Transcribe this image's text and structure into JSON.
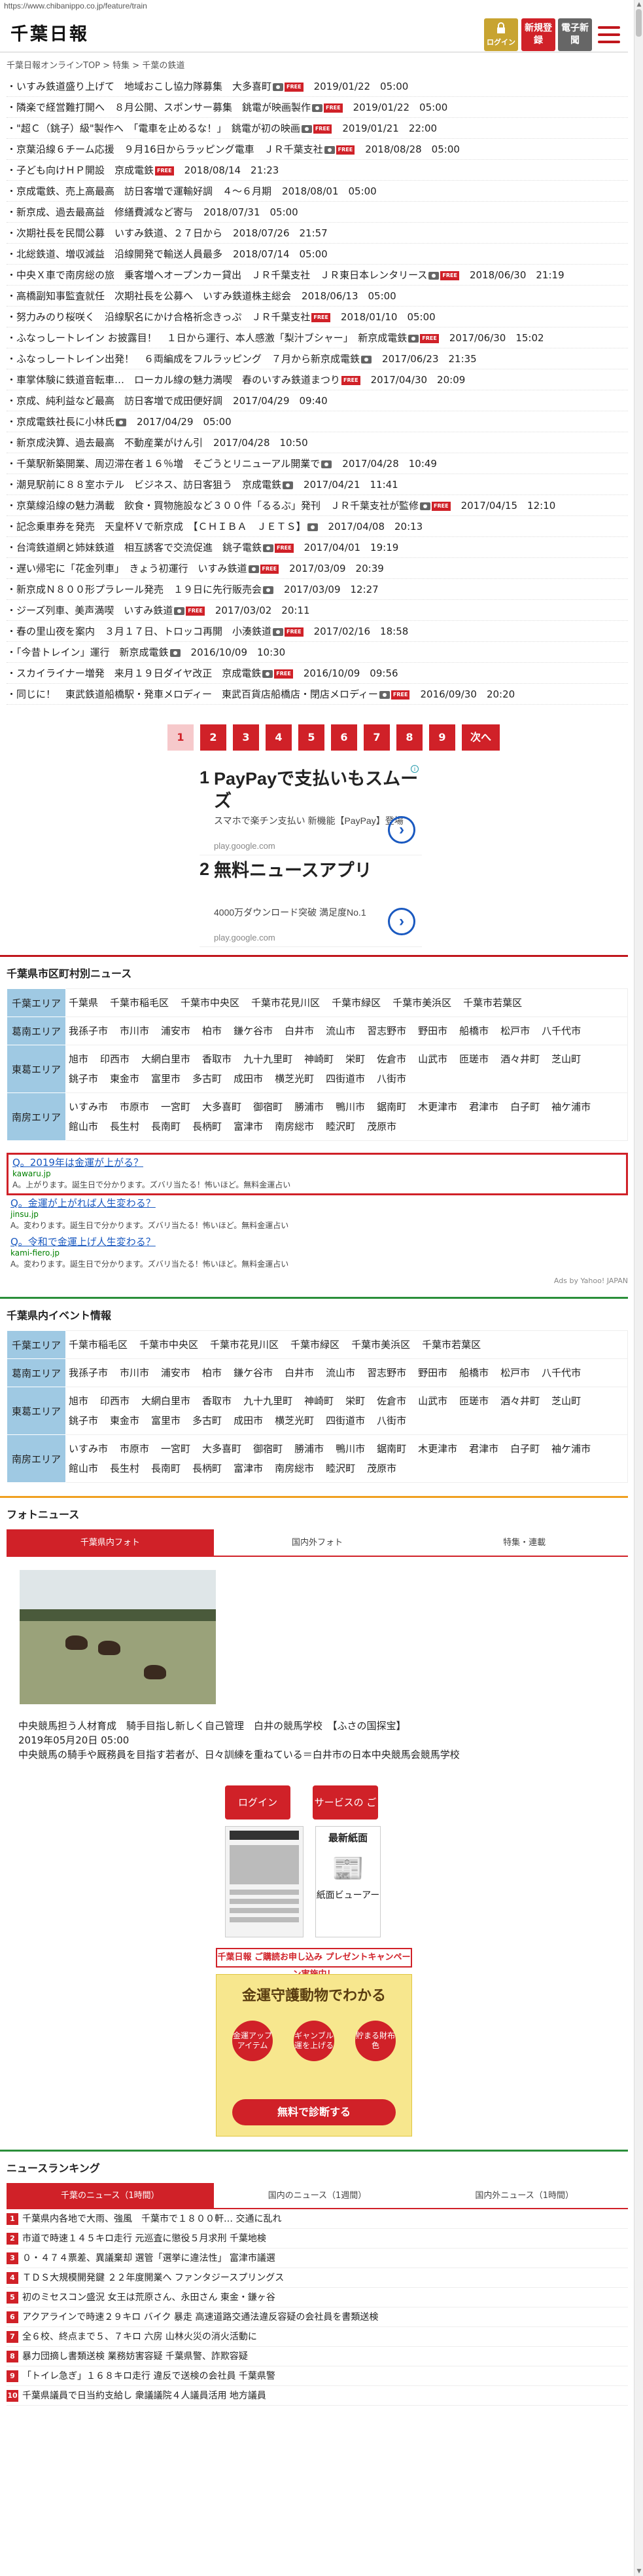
{
  "url": "https://www.chibanippo.co.jp/feature/train",
  "header": {
    "logo": "千葉日報",
    "login": "ログイン",
    "register": "新規登録",
    "paper": "電子新聞"
  },
  "breadcrumb": "千葉日報オンラインTOP > 特集 > 千葉の鉄道",
  "news": [
    {
      "text": "いすみ鉄道盛り上げて　地域おこし協力隊募集　大多喜町",
      "date": "2019/01/22　05:00",
      "icons": [
        "cam",
        "free"
      ]
    },
    {
      "text": "隣楽で経営難打開へ　８月公開、スポンサー募集　銚電が映画製作",
      "date": "2019/01/22　05:00",
      "icons": [
        "cam",
        "free"
      ]
    },
    {
      "text": "\"超Ｃ（銚子）級\"製作へ　「電車を止めるな！」　銚電が初の映画",
      "date": "2019/01/21　22:00",
      "icons": [
        "cam",
        "free"
      ]
    },
    {
      "text": "京葉沿線６チーム応援　９月16日からラッピング電車　ＪＲ千葉支社",
      "date": "2018/08/28　05:00",
      "icons": [
        "cam",
        "free"
      ]
    },
    {
      "text": "子ども向けＨＰ開設　京成電鉄",
      "date": "2018/08/14　21:23",
      "icons": [
        "free"
      ]
    },
    {
      "text": "京成電鉄、売上高最高　訪日客増で運輸好調　４～６月期",
      "date": "2018/08/01　05:00",
      "icons": []
    },
    {
      "text": "新京成、過去最高益　修繕費減など寄与",
      "date": "2018/07/31　05:00",
      "icons": []
    },
    {
      "text": "次期社長を民間公募　いすみ鉄道、２７日から",
      "date": "2018/07/26　21:57",
      "icons": []
    },
    {
      "text": "北総鉄道、増収減益　沿線開発で輸送人員最多",
      "date": "2018/07/14　05:00",
      "icons": []
    },
    {
      "text": "中央Ｘ車で南房総の旅　乗客増へオープンカー貸出　ＪＲ千葉支社　ＪＲ東日本レンタリース",
      "date": "2018/06/30　21:19",
      "icons": [
        "cam",
        "free"
      ]
    },
    {
      "text": "高橋副知事監査就任　次期社長を公募へ　いすみ鉄道株主総会",
      "date": "2018/06/13　05:00",
      "icons": []
    },
    {
      "text": "努力みのり桜咲く　沿線駅名にかけ合格祈念きっぷ　ＪＲ千葉支社",
      "date": "2018/01/10　05:00",
      "icons": [
        "free"
      ]
    },
    {
      "text": "ふなっしートレイン お披露目！　１日から運行、本人感激「梨汁ブシャー」　新京成電鉄",
      "date": "2017/06/30　15:02",
      "icons": [
        "cam",
        "free"
      ]
    },
    {
      "text": "ふなっしートレイン出発！　６両編成をフルラッピング　７月から新京成電鉄",
      "date": "2017/06/23　21:35",
      "icons": [
        "cam"
      ]
    },
    {
      "text": "車掌体験に鉄道音転車…　ローカル線の魅力満喫　春のいすみ鉄道まつり",
      "date": "2017/04/30　20:09",
      "icons": [
        "free"
      ]
    },
    {
      "text": "京成、純利益など最高　訪日客増で成田便好調",
      "date": "2017/04/29　09:40",
      "icons": []
    },
    {
      "text": "京成電鉄社長に小林氏",
      "date": "2017/04/29　05:00",
      "icons": [
        "cam"
      ]
    },
    {
      "text": "新京成決算、過去最高　不動産業がけん引",
      "date": "2017/04/28　10:50",
      "icons": []
    },
    {
      "text": "千葉駅新築開業、周辺滞在者１６％増　そごうとリニューアル開業で",
      "date": "2017/04/28　10:49",
      "icons": [
        "cam"
      ]
    },
    {
      "text": "潮見駅前に８８室ホテル　ビジネス、訪日客狙う　京成電鉄",
      "date": "2017/04/21　11:41",
      "icons": [
        "cam"
      ]
    },
    {
      "text": "京葉線沿線の魅力満載　飲食・買物施設など３００件「るるぶ」発刊　ＪＲ千葉支社が監修",
      "date": "2017/04/15　12:10",
      "icons": [
        "cam",
        "free"
      ]
    },
    {
      "text": "記念乗車券を発売　天皇杯Ｖで新京成　【ＣＨＩＢＡ　ＪＥＴＳ】",
      "date": "2017/04/08　20:13",
      "icons": [
        "cam"
      ]
    },
    {
      "text": "台湾鉄道網と姉妹鉄道　相互誘客で交流促進　銚子電鉄",
      "date": "2017/04/01　19:19",
      "icons": [
        "cam",
        "free"
      ]
    },
    {
      "text": "遅い帰宅に「花金列車」　きょう初運行　いすみ鉄道",
      "date": "2017/03/09　20:39",
      "icons": [
        "cam",
        "free"
      ]
    },
    {
      "text": "新京成Ｎ８００形プラレール発売　１９日に先行販売会",
      "date": "2017/03/09　12:27",
      "icons": [
        "cam"
      ]
    },
    {
      "text": "ジーズ列車、美声満喫　いすみ鉄道",
      "date": "2017/03/02　20:11",
      "icons": [
        "cam",
        "free"
      ]
    },
    {
      "text": "春の里山夜を案内　３月１７日、トロッコ再開　小湊鉄道",
      "date": "2017/02/16　18:58",
      "icons": [
        "cam",
        "free"
      ]
    },
    {
      "text": "「今昔トレイン」運行　新京成電鉄",
      "date": "2016/10/09　10:30",
      "icons": [
        "cam"
      ]
    },
    {
      "text": "スカイライナー増発　来月１９日ダイヤ改正　京成電鉄",
      "date": "2016/10/09　09:56",
      "icons": [
        "cam",
        "free"
      ]
    },
    {
      "text": "同じに！　東武鉄道船橋駅・発車メロディー　東武百貨店船橋店・閉店メロディー",
      "date": "2016/09/30　20:20",
      "icons": [
        "cam",
        "free"
      ]
    }
  ],
  "pager": {
    "pages": [
      "1",
      "2",
      "3",
      "4",
      "5",
      "6",
      "7",
      "8",
      "9"
    ],
    "next": "次へ"
  },
  "ad": [
    {
      "num": "1",
      "title": "PayPayで支払いもスムーズ",
      "sub": "スマホで楽チン支払い 新機能【PayPay】登場",
      "url": "play.google.com"
    },
    {
      "num": "2",
      "title": "無料ニュースアプリ",
      "sub": "4000万ダウンロード突破 満足度No.1",
      "url": "play.google.com"
    }
  ],
  "city_news": {
    "title": "千葉県市区町村別ニュース",
    "rows": [
      {
        "area": "千葉エリア",
        "cities": [
          "千葉県",
          "千葉市稲毛区",
          "千葉市中央区",
          "千葉市花見川区",
          "千葉市緑区",
          "千葉市美浜区",
          "千葉市若葉区"
        ]
      },
      {
        "area": "葛南エリア",
        "cities": [
          "我孫子市",
          "市川市",
          "浦安市",
          "柏市",
          "鎌ケ谷市",
          "白井市",
          "流山市",
          "習志野市",
          "野田市",
          "船橋市",
          "松戸市",
          "八千代市"
        ]
      },
      {
        "area": "東葛エリア",
        "cities": [
          "旭市",
          "印西市",
          "大網白里市",
          "香取市",
          "九十九里町",
          "神崎町",
          "栄町",
          "佐倉市",
          "山武市",
          "匝瑳市",
          "酒々井町",
          "芝山町",
          "銚子市",
          "東金市",
          "富里市",
          "多古町",
          "成田市",
          "横芝光町",
          "四街道市",
          "八街市"
        ]
      },
      {
        "area": "南房エリア",
        "cities": [
          "いすみ市",
          "市原市",
          "一宮町",
          "大多喜町",
          "御宿町",
          "勝浦市",
          "鴨川市",
          "鋸南町",
          "木更津市",
          "君津市",
          "白子町",
          "袖ケ浦市",
          "館山市",
          "長生村",
          "長南町",
          "長柄町",
          "富津市",
          "南房総市",
          "睦沢町",
          "茂原市"
        ]
      }
    ]
  },
  "yahoo_ads": [
    {
      "q": "Q。2019年は金運が上がる？",
      "d": "kawaru.jp",
      "a": "A。上がります。誕生日で分かります。ズバリ当たる！怖いほど。無料金運占い"
    },
    {
      "q": "Q。金運が上がれば人生変わる？",
      "d": "jinsu.jp",
      "a": "A。変わります。誕生日で分かります。ズバリ当たる！怖いほど。無料金運占い"
    },
    {
      "q": "Q。令和で金運上げ人生変わる？",
      "d": "kami-fiero.jp",
      "a": "A。変わります。誕生日で分かります。ズバリ当たる！怖いほど。無料金運占い"
    }
  ],
  "yahoo_src": "Ads by Yahoo! JAPAN",
  "event": {
    "title": "千葉県内イベント情報",
    "rows": [
      {
        "area": "千葉エリア",
        "cities": [
          "千葉市稲毛区",
          "千葉市中央区",
          "千葉市花見川区",
          "千葉市緑区",
          "千葉市美浜区",
          "千葉市若葉区"
        ]
      },
      {
        "area": "葛南エリア",
        "cities": [
          "我孫子市",
          "市川市",
          "浦安市",
          "柏市",
          "鎌ケ谷市",
          "白井市",
          "流山市",
          "習志野市",
          "野田市",
          "船橋市",
          "松戸市",
          "八千代市"
        ]
      },
      {
        "area": "東葛エリア",
        "cities": [
          "旭市",
          "印西市",
          "大網白里市",
          "香取市",
          "九十九里町",
          "神崎町",
          "栄町",
          "佐倉市",
          "山武市",
          "匝瑳市",
          "酒々井町",
          "芝山町",
          "銚子市",
          "東金市",
          "富里市",
          "多古町",
          "成田市",
          "横芝光町",
          "四街道市",
          "八街市"
        ]
      },
      {
        "area": "南房エリア",
        "cities": [
          "いすみ市",
          "市原市",
          "一宮町",
          "大多喜町",
          "御宿町",
          "勝浦市",
          "鴨川市",
          "鋸南町",
          "木更津市",
          "君津市",
          "白子町",
          "袖ケ浦市",
          "館山市",
          "長生村",
          "長南町",
          "長柄町",
          "富津市",
          "南房総市",
          "睦沢町",
          "茂原市"
        ]
      }
    ]
  },
  "photo": {
    "title": "フォトニュース",
    "tabs": [
      "千葉県内フォト",
      "国内外フォト",
      "特集・連載"
    ],
    "caption": "中央競馬担う人材育成　騎手目指し新しく自己管理　白井の競馬学校　【ふさの国探宝】",
    "date": "2019年05月20日 05:00",
    "summary": "中央競馬の騎手や厩務員を目指す若者が、日々訓練を重ねている＝白井市の日本中央競馬会競馬学校"
  },
  "login_box": {
    "login": "ログイン",
    "service": "サービスの ご案内",
    "latest": "最新紙面",
    "viewer": "紙面ビューアー"
  },
  "promo": {
    "bar": "千葉日報 ご購読お申し込み プレゼントキャンペーン実施中！",
    "title": "金運守護動物でわかる",
    "items": [
      "金運アップアイテム",
      "ギャンブル運を上げる",
      "貯まる財布色"
    ],
    "cta": "無料で診断する"
  },
  "ranking": {
    "title": "ニュースランキング",
    "tabs": [
      "千葉のニュース（1時間）",
      "国内のニュース（1週間）",
      "国内外ニュース（1時間）"
    ],
    "items": [
      "千葉県内各地で大雨、強風　千葉市で１８００軒… 交通に乱れ",
      "市道で時速１４５キロ走行 元巡査に懲役５月求刑 千葉地検",
      "０・４７４票差、異議棄却 選管「選挙に違法性」 富津市議選",
      "ＴＤＳ大規模開発鍵 ２２年度開業へ ファンタジースプリングス",
      "初のミセスコン盛況 女王は荒原さん、永田さん 東金・鎌ヶ谷",
      "アクアラインで時速２９キロ バイク 暴走 高速道路交通法違反容疑の会社員を書類送検",
      "全６校、終点まで５、７キロ 六房 山林火災の消火活動に",
      "暴力団摘し書類送検 業務妨害容疑 千葉県警、詐欺容疑",
      "「トイレ急ぎ」１６８キロ走行 違反で送検の会社員 千葉県警",
      "千葉県議員で日当約支給し 衆議議院４人議員活用 地方議員"
    ]
  }
}
